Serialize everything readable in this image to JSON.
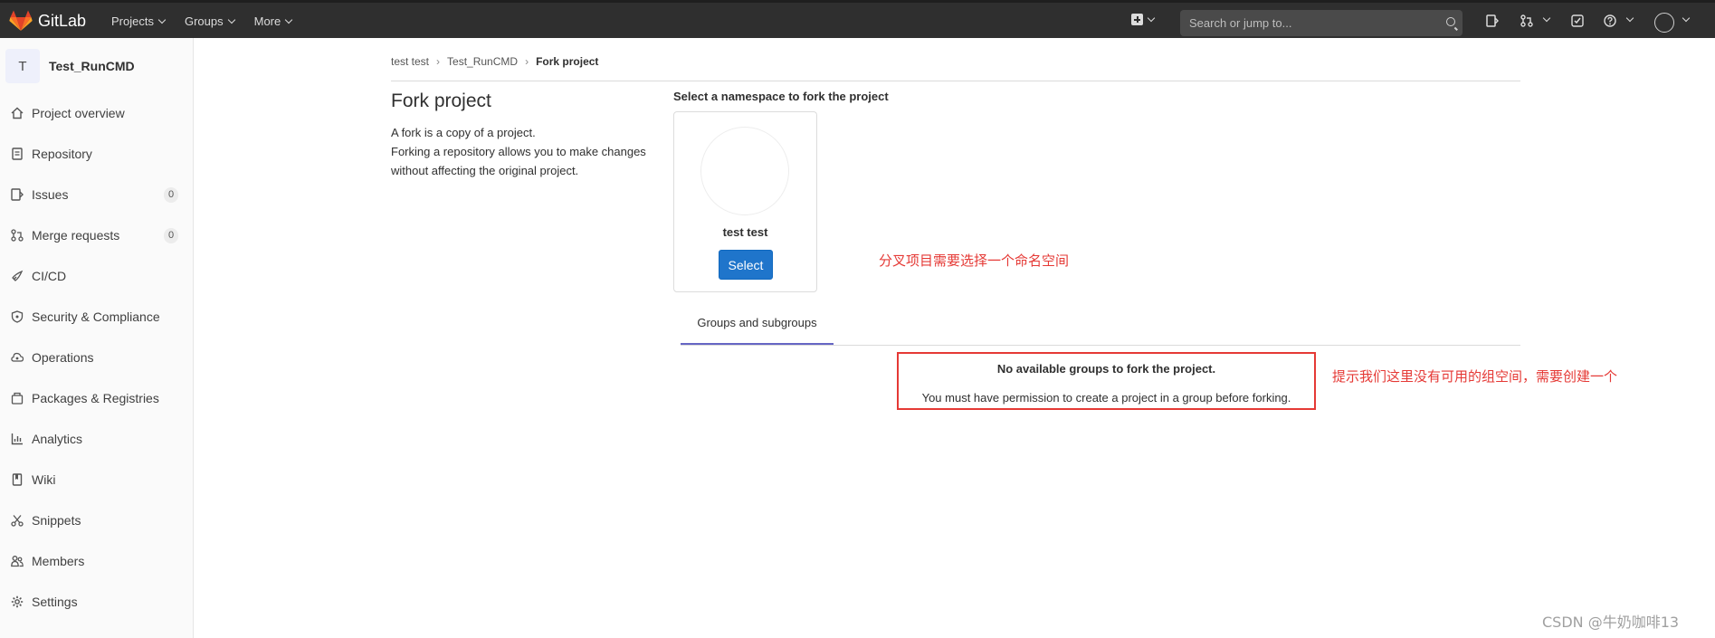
{
  "navbar": {
    "brand": "GitLab",
    "items": [
      {
        "label": "Projects"
      },
      {
        "label": "Groups"
      },
      {
        "label": "More"
      }
    ],
    "search_placeholder": "Search or jump to...",
    "icons": [
      "plus-square-icon",
      "search-icon",
      "issues-icon",
      "merge-request-icon",
      "todo-icon",
      "help-icon",
      "user-avatar-icon"
    ]
  },
  "sidebar": {
    "avatar_letter": "T",
    "project_name": "Test_RunCMD",
    "items": [
      {
        "label": "Project overview",
        "icon": "home-icon"
      },
      {
        "label": "Repository",
        "icon": "doc-icon"
      },
      {
        "label": "Issues",
        "icon": "issues-icon",
        "count": "0"
      },
      {
        "label": "Merge requests",
        "icon": "merge-request-icon",
        "count": "0"
      },
      {
        "label": "CI/CD",
        "icon": "rocket-icon"
      },
      {
        "label": "Security & Compliance",
        "icon": "shield-icon"
      },
      {
        "label": "Operations",
        "icon": "cloud-gear-icon"
      },
      {
        "label": "Packages & Registries",
        "icon": "package-icon"
      },
      {
        "label": "Analytics",
        "icon": "chart-icon"
      },
      {
        "label": "Wiki",
        "icon": "book-icon"
      },
      {
        "label": "Snippets",
        "icon": "scissors-icon"
      },
      {
        "label": "Members",
        "icon": "users-icon"
      },
      {
        "label": "Settings",
        "icon": "gear-icon"
      }
    ]
  },
  "breadcrumb": {
    "items": [
      "test test",
      "Test_RunCMD"
    ],
    "current": "Fork project"
  },
  "main": {
    "title": "Fork project",
    "desc_line1": "A fork is a copy of a project.",
    "desc_line2": "Forking a repository allows you to make changes without affecting the original project.",
    "namespace_heading": "Select a namespace to fork the project",
    "namespace_name": "test test",
    "select_label": "Select",
    "tab_label": "Groups and subgroups",
    "empty_title": "No available groups to fork the project.",
    "empty_text": "You must have permission to create a project in a group before forking."
  },
  "annotations": {
    "note1": "分叉项目需要选择一个命名空间",
    "note2": "提示我们这里没有可用的组空间，需要创建一个",
    "color": "#e53935"
  },
  "watermark": "CSDN @牛奶咖啡13",
  "colors": {
    "navbar_bg": "#2f2f2f",
    "primary_button": "#1f75cb",
    "tab_underline": "#6666c4"
  }
}
